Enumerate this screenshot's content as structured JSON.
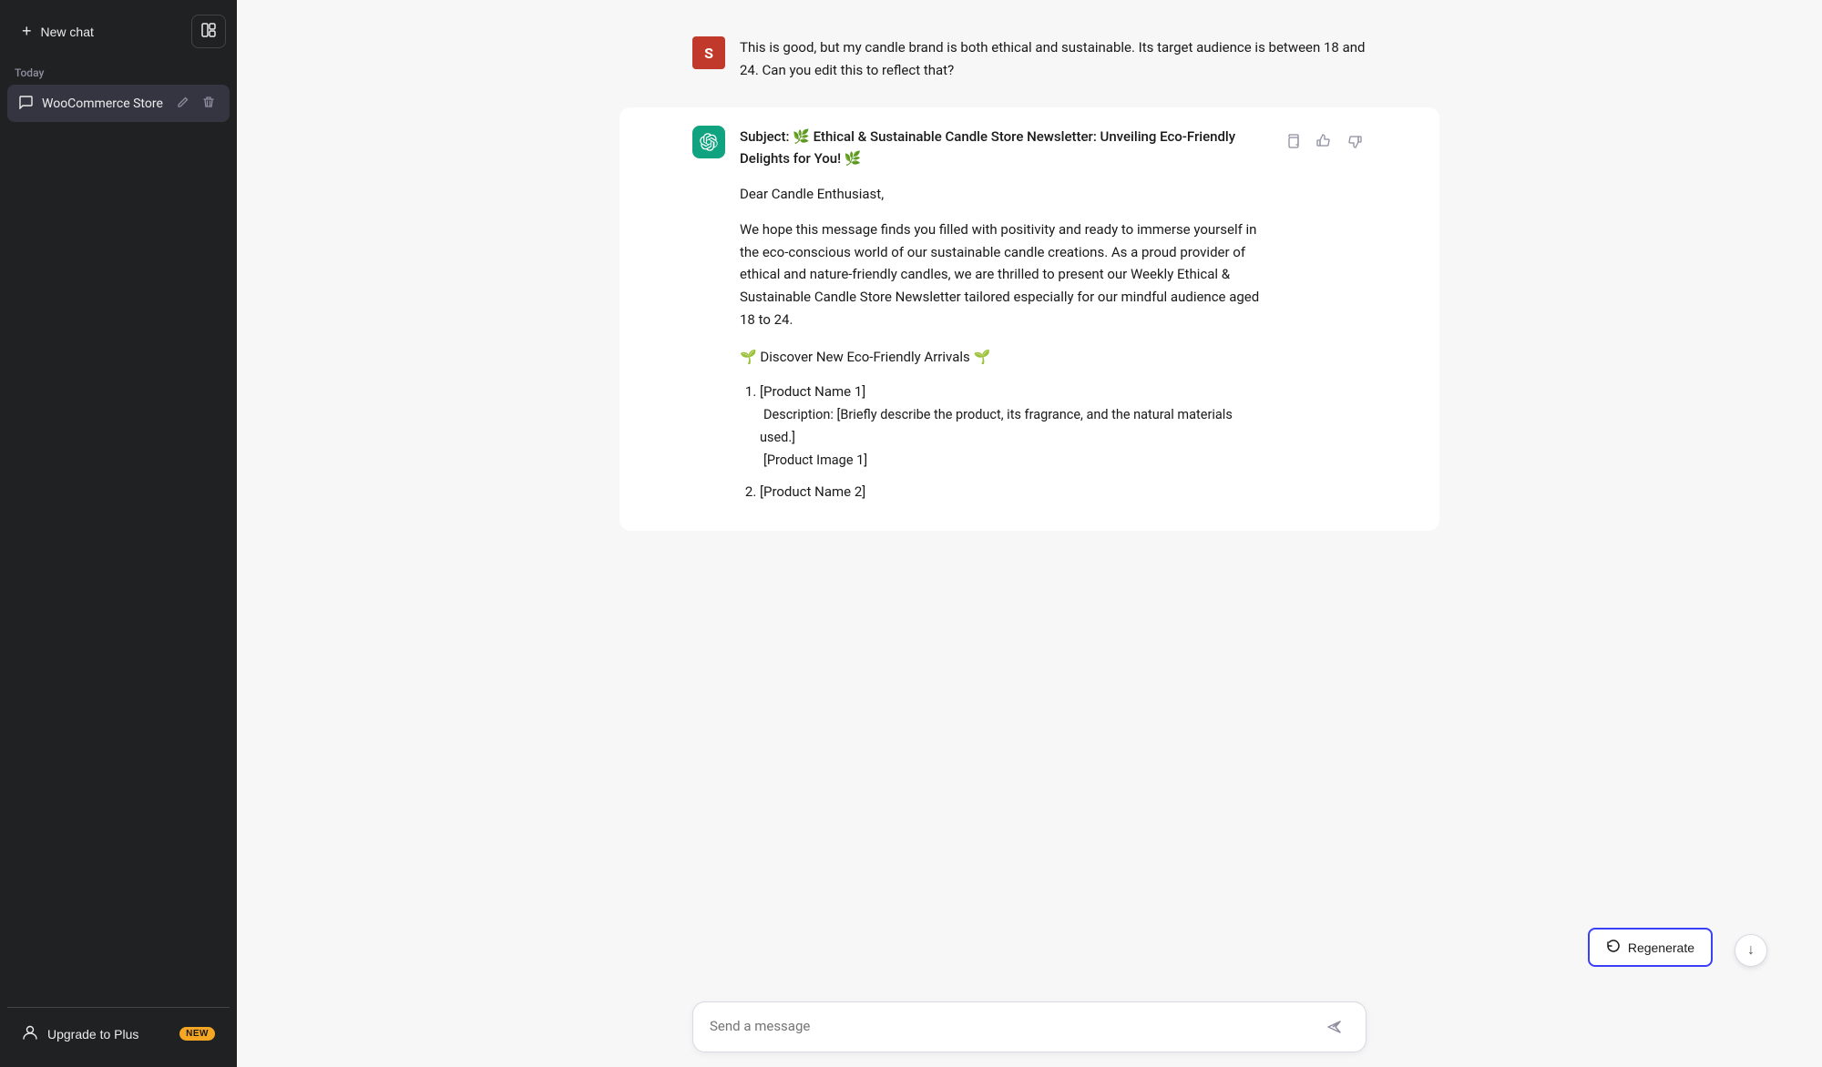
{
  "sidebar": {
    "new_chat_label": "New chat",
    "layout_icon": "⊡",
    "today_label": "Today",
    "chat_item_label": "WooCommerce Store",
    "edit_icon": "✎",
    "delete_icon": "🗑",
    "footer": {
      "upgrade_label": "Upgrade to Plus",
      "badge": "NEW",
      "user_icon": "👤"
    }
  },
  "chat": {
    "user_avatar_letter": "S",
    "assistant_avatar": "✦",
    "user_message": "This is good, but my candle brand is both ethical and sustainable. Its target audience is between 18 and 24. Can you edit this to reflect that?",
    "assistant_response": {
      "subject": "Subject: 🌿 Ethical & Sustainable Candle Store Newsletter: Unveiling Eco-Friendly Delights for You! 🌿",
      "greeting": "Dear Candle Enthusiast,",
      "body": "We hope this message finds you filled with positivity and ready to immerse yourself in the eco-conscious world of our sustainable candle creations. As a proud provider of ethical and nature-friendly candles, we are thrilled to present our Weekly Ethical & Sustainable Candle Store Newsletter tailored especially for our mindful audience aged 18 to 24.",
      "section_header": "🌱 Discover New Eco-Friendly Arrivals 🌱",
      "products": [
        {
          "name": "[Product Name 1]",
          "description": "Description: [Briefly describe the product, its fragrance, and the natural materials used.]",
          "image": "[Product Image 1]"
        },
        {
          "name": "[Product Name 2]",
          "description": ""
        }
      ]
    },
    "copy_icon": "⎘",
    "thumbup_icon": "👍",
    "thumbdown_icon": "👎"
  },
  "input": {
    "placeholder": "Send a message",
    "send_icon": "▶"
  },
  "regenerate_label": "Regenerate",
  "regenerate_icon": "↻",
  "scroll_down_icon": "↓"
}
